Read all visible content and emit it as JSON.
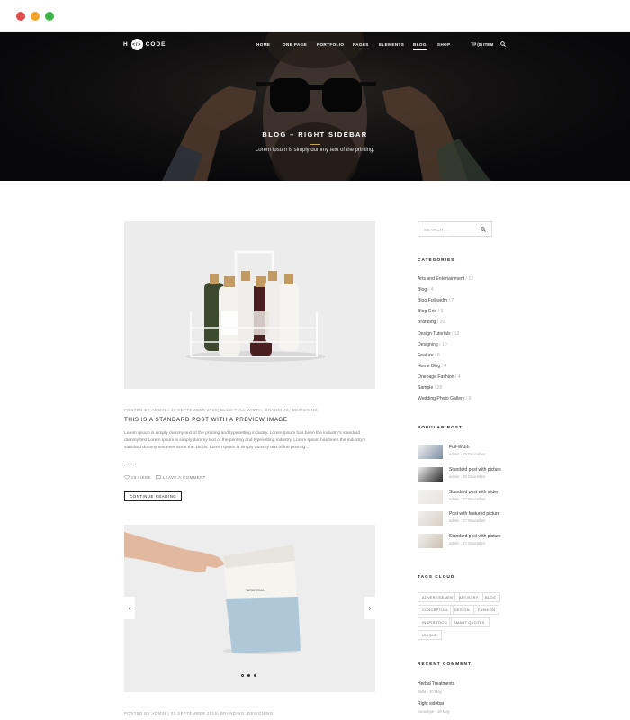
{
  "chrome": {
    "dots": [
      "#e0504a",
      "#f0a52a",
      "#3fb64a"
    ]
  },
  "nav": {
    "logo_left": "H",
    "logo_mark": "</>",
    "logo_right": "CODE",
    "items": [
      "HOME",
      "ONE PAGE",
      "PORTFOLIO",
      "PAGES",
      "ELEMENTS",
      "BLOG",
      "SHOP"
    ],
    "active": "BLOG",
    "cart_label": "(0) ITEM"
  },
  "hero": {
    "title": "BLOG – RIGHT SIDEBAR",
    "subtitle": "Lorem Ipsum is simply dummy text of the printing."
  },
  "posts": [
    {
      "meta": "POSTED BY ADMIN | 23 SEPTEMBER 2015| BLOG FULL WIDTH, BRANDING, DESIGNING",
      "title": "THIS IS A STANDARD POST WITH A PREVIEW IMAGE",
      "excerpt": "Lorem Ipsum is simply dummy text of the printing and typesetting industry. Lorem Ipsum has been the industry's standard dummy text Lorem Ipsum is simply dummy text of the printing and typesetting industry. Lorem Ipsum has been the industry's standard dummy text ever since the 1500s. Lorem Ipsum is simply dummy text of the printing...",
      "likes": "18 LIKES",
      "comment": "LEAVE A COMMENT",
      "button": "CONTINUE READING"
    },
    {
      "meta": "POSTED BY ADMIN | 23 SEPTEMBER 2015| BRANDING, DESIGNING",
      "slider_prev": "‹",
      "slider_next": "›"
    }
  ],
  "sidebar": {
    "search_placeholder": "SEARCH...",
    "categories_heading": "CATEGORIES",
    "categories": [
      {
        "name": "Arts and Entertainment",
        "count": "/ 12"
      },
      {
        "name": "Blog",
        "count": "/ 4"
      },
      {
        "name": "Blog Full width",
        "count": "/ 7"
      },
      {
        "name": "Blog Grid",
        "count": "/ 9"
      },
      {
        "name": "Branding",
        "count": "/ 10"
      },
      {
        "name": "Design Tutorials",
        "count": "/ 12"
      },
      {
        "name": "Designing",
        "count": "/ 10"
      },
      {
        "name": "Feature",
        "count": "/ 8"
      },
      {
        "name": "Home Blog",
        "count": "/ 4"
      },
      {
        "name": "Onepage Fashion",
        "count": "/ 4"
      },
      {
        "name": "Sample",
        "count": "/ 28"
      },
      {
        "name": "Wedding Photo Gallery",
        "count": "/ 9"
      }
    ],
    "popular_heading": "POPULAR POST",
    "popular": [
      {
        "title": "Full-Width",
        "date": "admin - 10 December"
      },
      {
        "title": "Standard post with picture",
        "date": "admin - 30 December"
      },
      {
        "title": "Standard post with slider",
        "date": "admin - 27 November"
      },
      {
        "title": "Post with featured picture",
        "date": "admin - 27 November"
      },
      {
        "title": "Standard post with picture",
        "date": "admin - 27 November"
      }
    ],
    "tags_heading": "TAGS CLOUD",
    "tags": [
      "ADVERTISEMENT",
      "ARTISTRY",
      "BLOG",
      "CONCEPTUAL",
      "DESIGN",
      "FASHION",
      "INSPIRATION",
      "SMART QUOTES",
      "UNIQUE"
    ],
    "comments_heading": "RECENT COMMENT",
    "comments": [
      {
        "title": "Herbal Treatments",
        "sub": "Bella - 10 May"
      },
      {
        "title": "Right sidebar",
        "sub": "exoushpe - 18 May"
      }
    ]
  }
}
